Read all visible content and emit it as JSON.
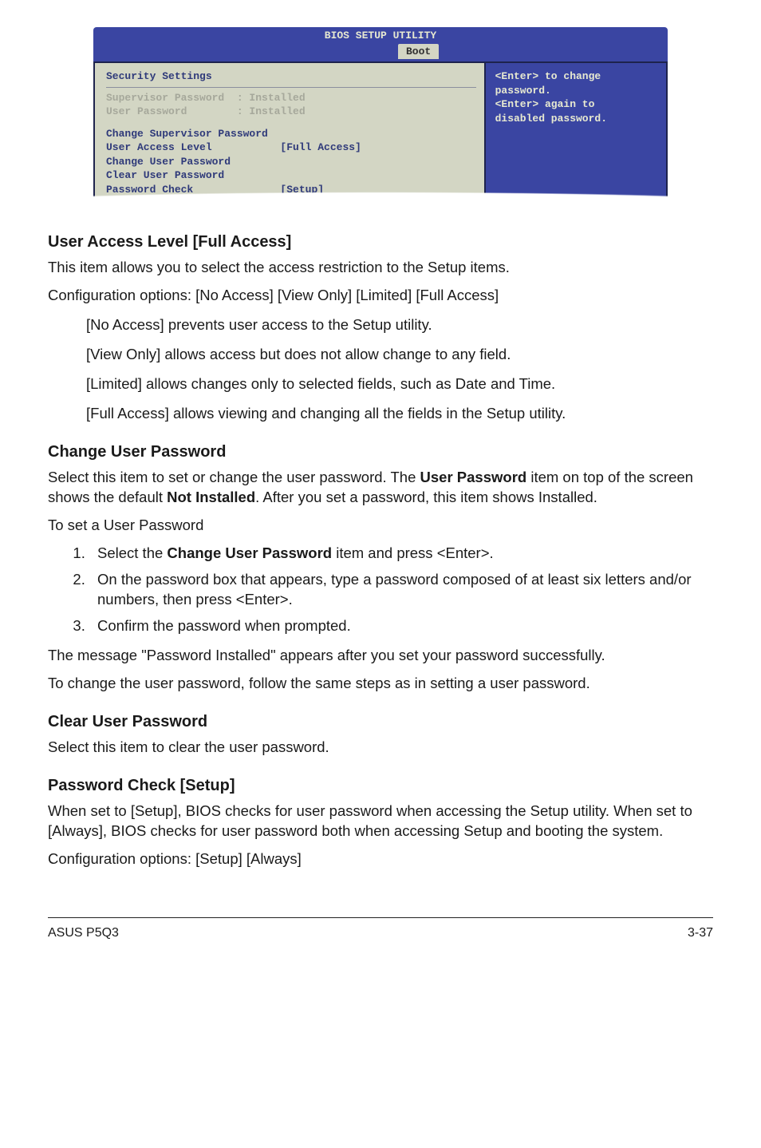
{
  "bios": {
    "utility_title": "BIOS SETUP UTILITY",
    "tab_boot": "Boot",
    "left": {
      "heading": "Security Settings",
      "status_supervisor": "Supervisor Password  : Installed",
      "status_user": "User Password        : Installed",
      "item_change_super": "Change Supervisor Password",
      "item_access": "User Access Level           [Full Access]",
      "item_change_user": "Change User Password",
      "item_clear_user": "Clear User Password",
      "item_pw_check": "Password Check              [Setup]"
    },
    "help": {
      "line1": "<Enter> to change",
      "line2": "password.",
      "line3": "<Enter> again to",
      "line4": "disabled password."
    }
  },
  "s1": {
    "heading": "User Access Level [Full Access]",
    "p1": "This item allows you to select the access restriction to the Setup items.",
    "p2": "Configuration options: [No Access] [View Only] [Limited] [Full Access]",
    "opt1": "[No Access] prevents user access to the Setup utility.",
    "opt2": "[View Only] allows access but does not allow change to any field.",
    "opt3": "[Limited] allows changes only to selected fields, such as Date and Time.",
    "opt4": "[Full Access] allows viewing and changing all the fields in the Setup utility."
  },
  "s2": {
    "heading": "Change User Password",
    "p1a": "Select this item to set or change the user password. The ",
    "p1b": "User Password",
    "p1c": " item on top of the screen shows the default ",
    "p1d": "Not Installed",
    "p1e": ". After you set a password, this item shows Installed.",
    "p2": "To set a User Password",
    "li1a": "Select the ",
    "li1b": "Change User Password",
    "li1c": " item and press <Enter>.",
    "li2": "On the password box that appears, type a password composed of at least six letters and/or numbers, then press <Enter>.",
    "li3": "Confirm the password when prompted.",
    "p3": "The message \"Password Installed\" appears after you set your password successfully.",
    "p4": "To change the user password, follow the same steps as in setting a user password."
  },
  "s3": {
    "heading": "Clear User Password",
    "p1": "Select this item to clear the user password."
  },
  "s4": {
    "heading": "Password Check [Setup]",
    "p1": "When set to [Setup], BIOS checks for user password when accessing the Setup utility. When set to [Always], BIOS checks for user password both when accessing Setup and booting the system.",
    "p2": "Configuration options: [Setup] [Always]"
  },
  "footer": {
    "left": "ASUS P5Q3",
    "right": "3-37"
  }
}
